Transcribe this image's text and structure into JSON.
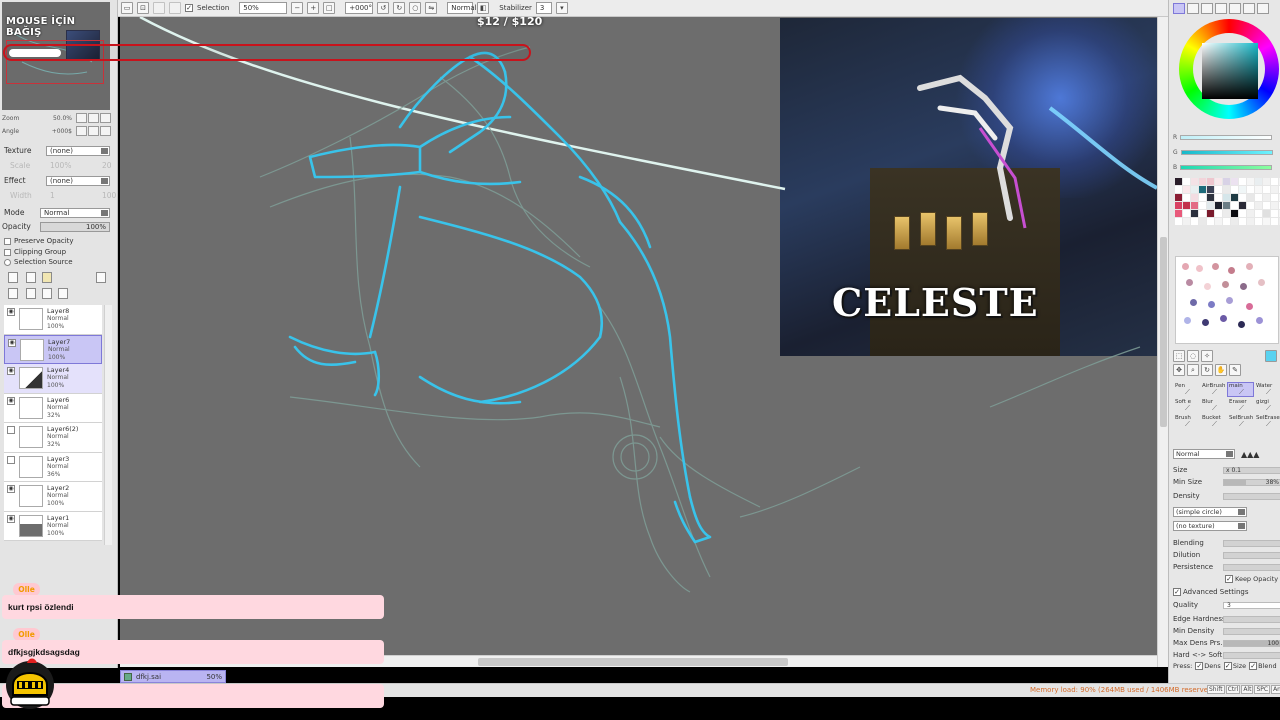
{
  "toolbar": {
    "selection_label": "Selection",
    "zoom_value": "50%",
    "rotation_value": "+000°",
    "blend_mode": "Normal",
    "stabilizer_label": "Stabilizer",
    "stabilizer_value": "3"
  },
  "overlay": {
    "title": "MOUSE İÇİN BAĞIŞ",
    "price": "$12 / $120",
    "donation_progress": 0.1
  },
  "navigator": {
    "zoom_label": "Zoom",
    "zoom_value": "50.0%",
    "angle_label": "Angle",
    "angle_value": "+000$"
  },
  "properties": {
    "texture_label": "Texture",
    "texture_value": "(none)",
    "scale_label": "Scale",
    "scale_value": "100%",
    "scale_num": "20",
    "effect_label": "Effect",
    "effect_value": "(none)",
    "width_label": "Width",
    "width_value": "1",
    "width_num": "100",
    "mode_label": "Mode",
    "mode_value": "Normal",
    "opacity_label": "Opacity",
    "opacity_value": "100%",
    "preserve_opacity": "Preserve Opacity",
    "clipping_group": "Clipping Group",
    "selection_source": "Selection Source"
  },
  "layers": [
    {
      "name": "Layer8",
      "mode": "Normal",
      "opacity": "100%",
      "visible": true
    },
    {
      "name": "Layer7",
      "mode": "Normal",
      "opacity": "100%",
      "visible": true
    },
    {
      "name": "Layer4",
      "mode": "Normal",
      "opacity": "100%",
      "visible": true
    },
    {
      "name": "Layer6",
      "mode": "Normal",
      "opacity": "32%",
      "visible": true
    },
    {
      "name": "Layer6(2)",
      "mode": "Normal",
      "opacity": "32%",
      "visible": false
    },
    {
      "name": "Layer3",
      "mode": "Normal",
      "opacity": "36%",
      "visible": false
    },
    {
      "name": "Layer2",
      "mode": "Normal",
      "opacity": "100%",
      "visible": true
    },
    {
      "name": "Layer1",
      "mode": "Normal",
      "opacity": "100%",
      "visible": true
    }
  ],
  "chat": [
    {
      "user": "Olle",
      "message": "kurt rpsi özlendi"
    },
    {
      "user": "Olle",
      "message": "dfkjsgjkdsagsdag"
    }
  ],
  "file_tab": {
    "name": "dfkj.sai",
    "zoom": "50%"
  },
  "status": {
    "memory": "Memory load: 90% (264MB used / 1406MB reserved)",
    "keys": [
      "Shift",
      "Ctrl",
      "Alt",
      "SPC",
      "Any"
    ]
  },
  "reference": {
    "logo_text": "CELESTE"
  },
  "right_panel": {
    "slider_r": "R",
    "slider_g": "G",
    "slider_b": "B",
    "tools": [
      "Pen",
      "AirBrush",
      "main",
      "Water",
      "Soft e",
      "Blur",
      "Eraser",
      "gizgi",
      "Brush",
      "Bucket",
      "SelBrush",
      "SelEraser"
    ],
    "blend_mode": "Normal",
    "size_label": "Size",
    "size_value": "x 0.1",
    "min_size_label": "Min Size",
    "min_size_value": "38%",
    "density_label": "Density",
    "shape_value": "(simple circle)",
    "texture_value": "(no texture)",
    "blending_label": "Blending",
    "dilution_label": "Dilution",
    "persistence_label": "Persistence",
    "keep_opacity": "Keep Opacity",
    "advanced_settings": "Advanced Settings",
    "quality_label": "Quality",
    "quality_value": "3",
    "edge_hardness_label": "Edge Hardness",
    "min_density_label": "Min Density",
    "max_dens_label": "Max Dens Prs.",
    "max_dens_value": "100",
    "hard_soft_label": "Hard <-> Soft",
    "press_label": "Press:",
    "press_dens": "Dens",
    "press_size": "Size",
    "press_blend": "Blend"
  },
  "colors": {
    "accent": "#7e78d8",
    "sketch_cyan": "#39c3ea",
    "sketch_faint": "#86aaa2",
    "chat_bg": "#ffd8e0",
    "chat_user": "#f29a00",
    "donation_bar": "#c8131c"
  }
}
